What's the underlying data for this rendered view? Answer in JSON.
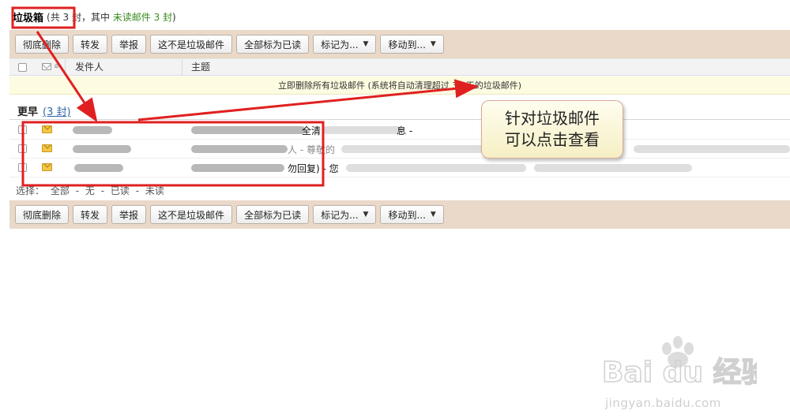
{
  "folder": {
    "name": "垃圾箱",
    "summary_prefix": "(共 3 封，其中 ",
    "unread_label": "未读邮件 3 封",
    "summary_suffix": ")"
  },
  "toolbar": {
    "delete_forever": "彻底删除",
    "forward": "转发",
    "report": "举报",
    "not_spam": "这不是垃圾邮件",
    "mark_all_read": "全部标为已读",
    "mark_as": "标记为...",
    "move_to": "移动到..."
  },
  "columns": {
    "sender": "发件人",
    "subject": "主题"
  },
  "notice": "立即删除所有垃圾邮件 (系统将自动清理超过 30 天的垃圾邮件)",
  "group": {
    "label": "更早",
    "count": "(3 封)"
  },
  "mails": [
    {
      "subject_fragment": "全清",
      "trail_fragment": "息 -"
    },
    {
      "subject_fragment": "人 - 尊敬的"
    },
    {
      "subject_fragment": "勿回复) - 您"
    }
  ],
  "selection": {
    "prefix": "选择：",
    "all": "全部",
    "none": "无",
    "read": "已读",
    "unread": "未读",
    "sep": "-"
  },
  "callout": {
    "text": "针对垃圾邮件\n可以点击查看"
  },
  "watermark": {
    "logo_text": "Bai du 经验",
    "url": "jingyan.baidu.com"
  },
  "colors": {
    "toolbar_bg": "#ead9c9",
    "unread_green": "#3a8a1e",
    "annotation_red": "#e02020",
    "notice_bg": "#fdfbe0"
  }
}
